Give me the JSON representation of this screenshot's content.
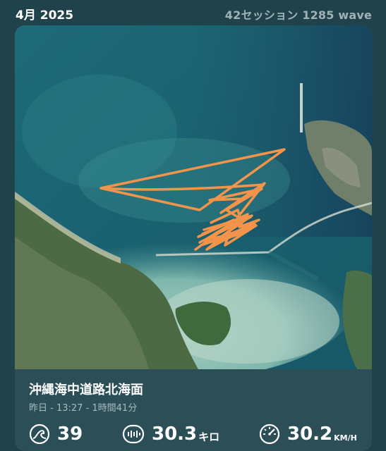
{
  "header": {
    "month": "4月 2025",
    "stats": "42セッション  1285 wave"
  },
  "session": {
    "spot_name": "沖縄海中道路北海面",
    "meta": "昨日 - 13:27 - 1時間41分",
    "waves": {
      "value": "39",
      "icon": "wave-icon"
    },
    "distance": {
      "value": "30.3",
      "unit": "キロ",
      "icon": "distance-icon"
    },
    "speed": {
      "value": "30.2",
      "unit": "KM/H",
      "icon": "speedometer-icon"
    }
  },
  "colors": {
    "background": "#20424b",
    "card_info": "#2b4e57",
    "track": "#f4944a",
    "muted_text": "#9fb2b6"
  }
}
